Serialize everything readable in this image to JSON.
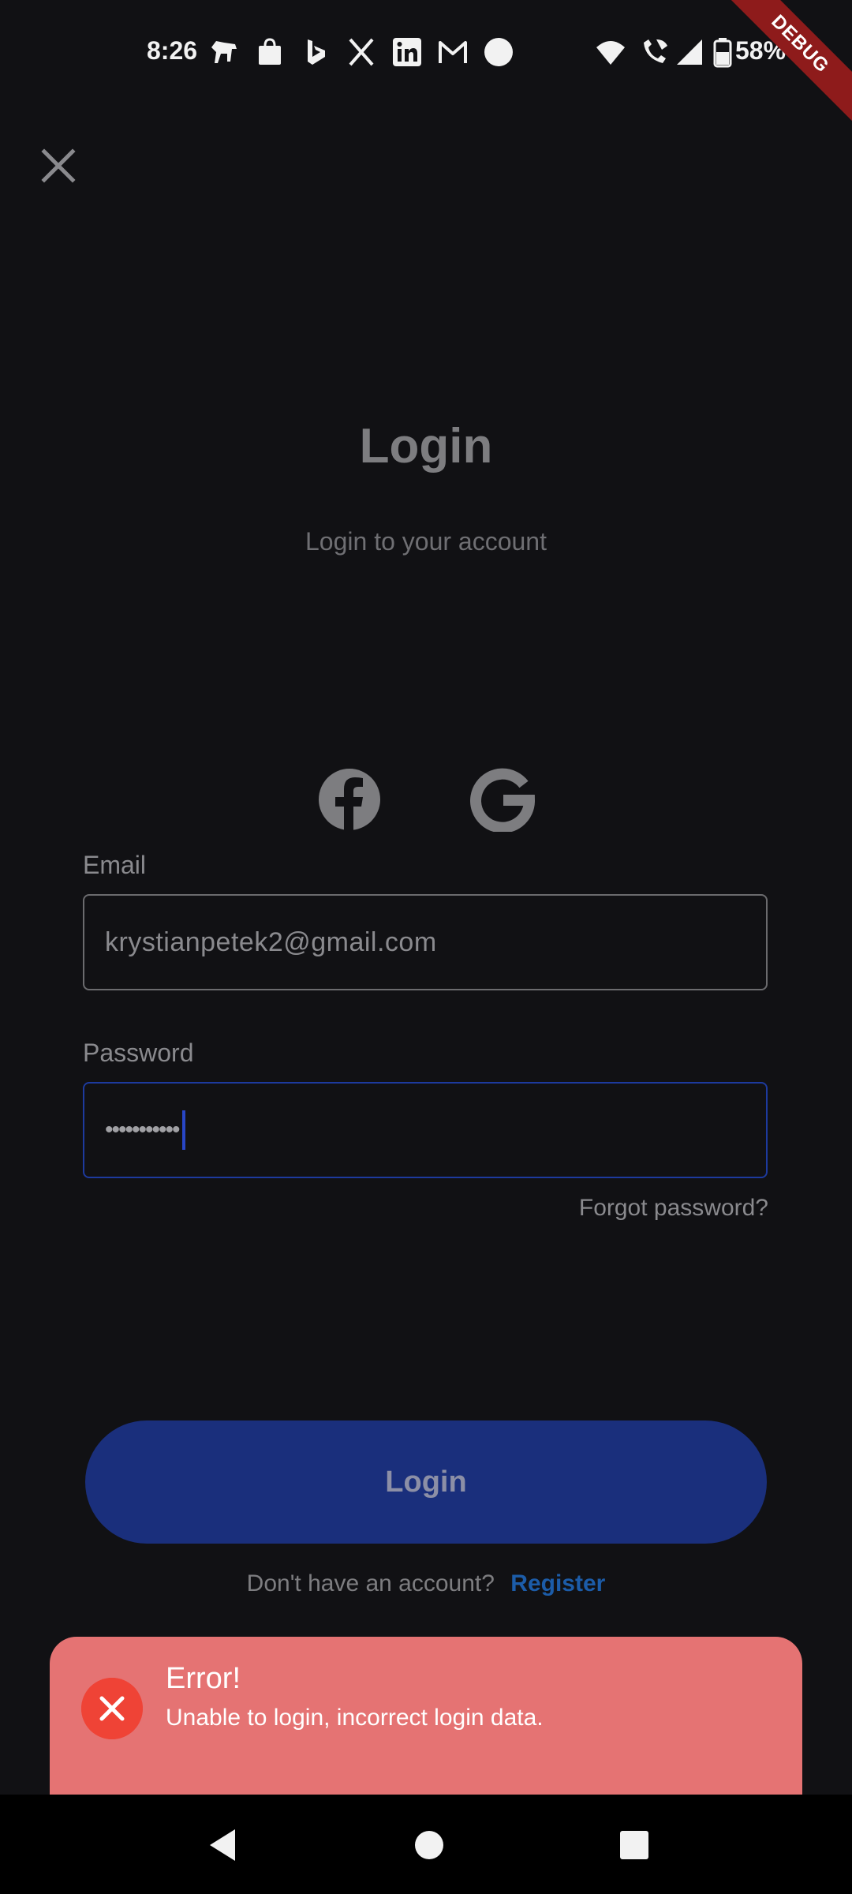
{
  "status_bar": {
    "time": "8:26",
    "battery": "58%",
    "left_icons": [
      "dog-icon",
      "shopping-bag-icon",
      "bing-icon",
      "x-icon",
      "linkedin-icon",
      "gmail-icon",
      "circle-icon"
    ],
    "right_icons": [
      "wifi-icon",
      "wifi-call-icon",
      "signal-icon",
      "battery-icon"
    ]
  },
  "debug_banner": "DEBUG",
  "header": {
    "title": "Login",
    "subtitle": "Login to your account"
  },
  "social": {
    "facebook_icon": "facebook-icon",
    "google_icon": "google-icon"
  },
  "form": {
    "email_label": "Email",
    "email_value": "krystianpetek2@gmail.com",
    "password_label": "Password",
    "password_value": "•••••••••••",
    "forgot_label": "Forgot password?"
  },
  "actions": {
    "login_label": "Login",
    "register_prompt": "Don't have an account?",
    "register_label": "Register"
  },
  "snackbar": {
    "title": "Error!",
    "message": "Unable to login, incorrect login data."
  },
  "colors": {
    "background": "#111114",
    "primary": "#1a2f7c",
    "error": "#e57373",
    "link": "#1c5ca8"
  }
}
